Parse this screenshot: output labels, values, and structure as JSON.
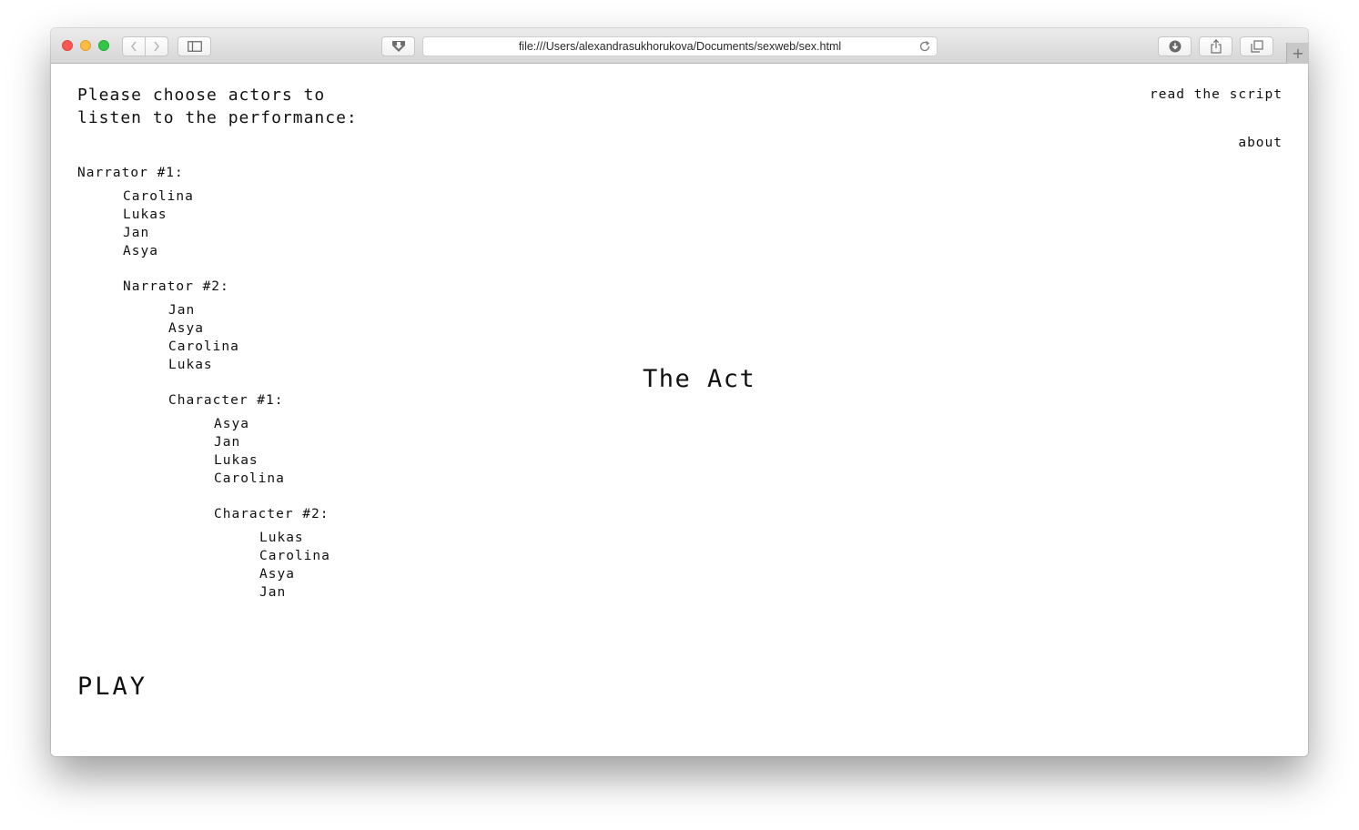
{
  "browser": {
    "url": "file:///Users/alexandrasukhorukova/Documents/sexweb/sex.html"
  },
  "page": {
    "prompt_line1": "Please choose actors to",
    "prompt_line2": "listen to the performance:",
    "nav": {
      "read_script": "read the script",
      "about": "about"
    },
    "title": "The Act",
    "play": "PLAY",
    "roles": [
      {
        "label": "Narrator #1:",
        "actors": [
          "Carolina",
          "Lukas",
          "Jan",
          "Asya"
        ]
      },
      {
        "label": "Narrator #2:",
        "actors": [
          "Jan",
          "Asya",
          "Carolina",
          "Lukas"
        ]
      },
      {
        "label": "Character #1:",
        "actors": [
          "Asya",
          "Jan",
          "Lukas",
          "Carolina"
        ]
      },
      {
        "label": "Character #2:",
        "actors": [
          "Lukas",
          "Carolina",
          "Asya",
          "Jan"
        ]
      }
    ]
  }
}
